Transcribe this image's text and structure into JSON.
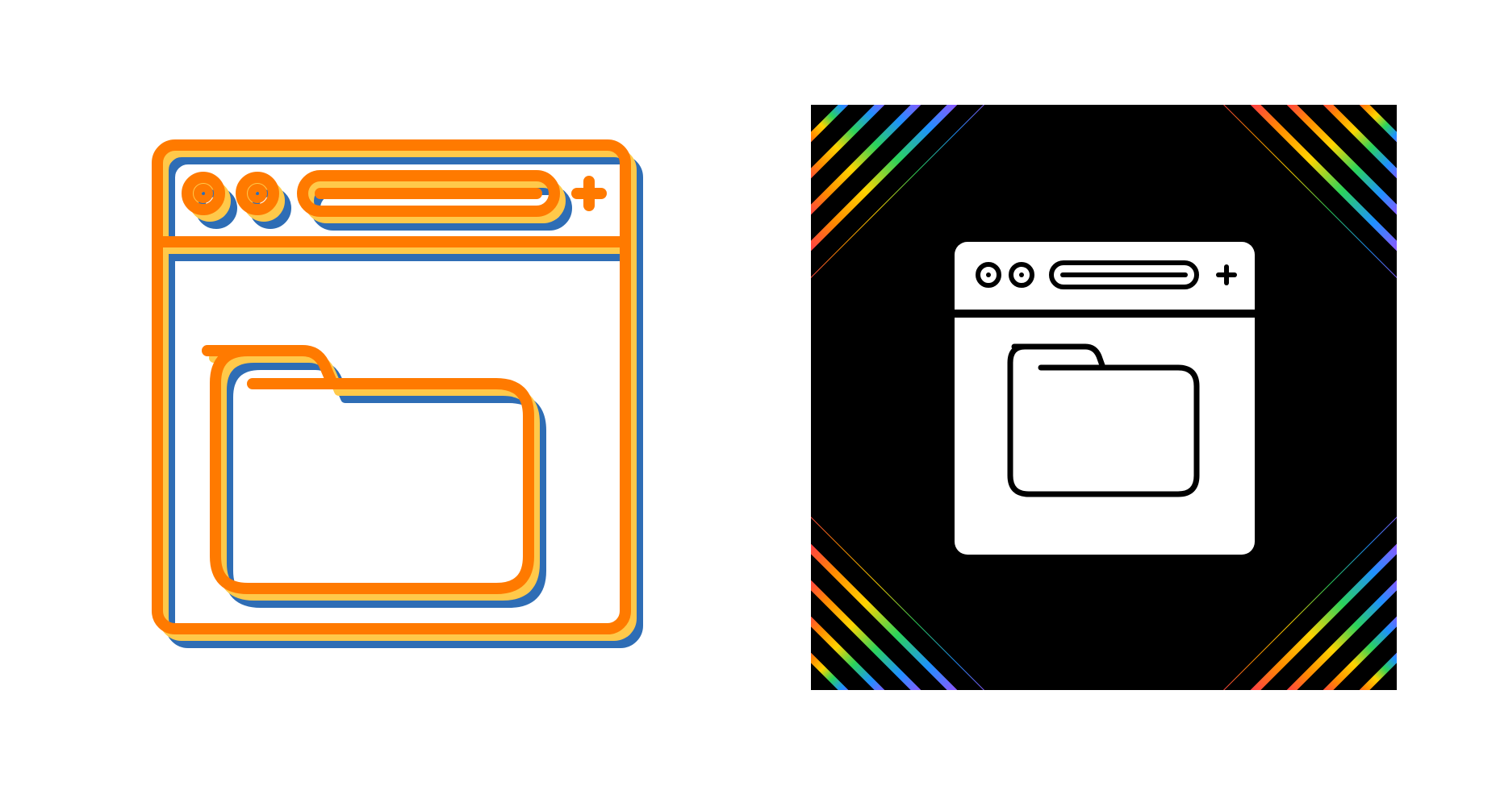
{
  "icons": [
    {
      "name": "browser-folder-icon",
      "style": "layered-outline",
      "colors": {
        "primary": "#FF7A00",
        "layer_yellow": "#FFC94A",
        "layer_blue": "#2E6DB5"
      }
    },
    {
      "name": "browser-folder-icon",
      "style": "glyph-on-black",
      "colors": {
        "background": "#000000",
        "glyph": "#FFFFFF",
        "corner_stripes": [
          "#FF2D55",
          "#FF8A00",
          "#FFD400",
          "#2BD35A",
          "#1E90FF",
          "#A64CFF"
        ]
      }
    }
  ]
}
